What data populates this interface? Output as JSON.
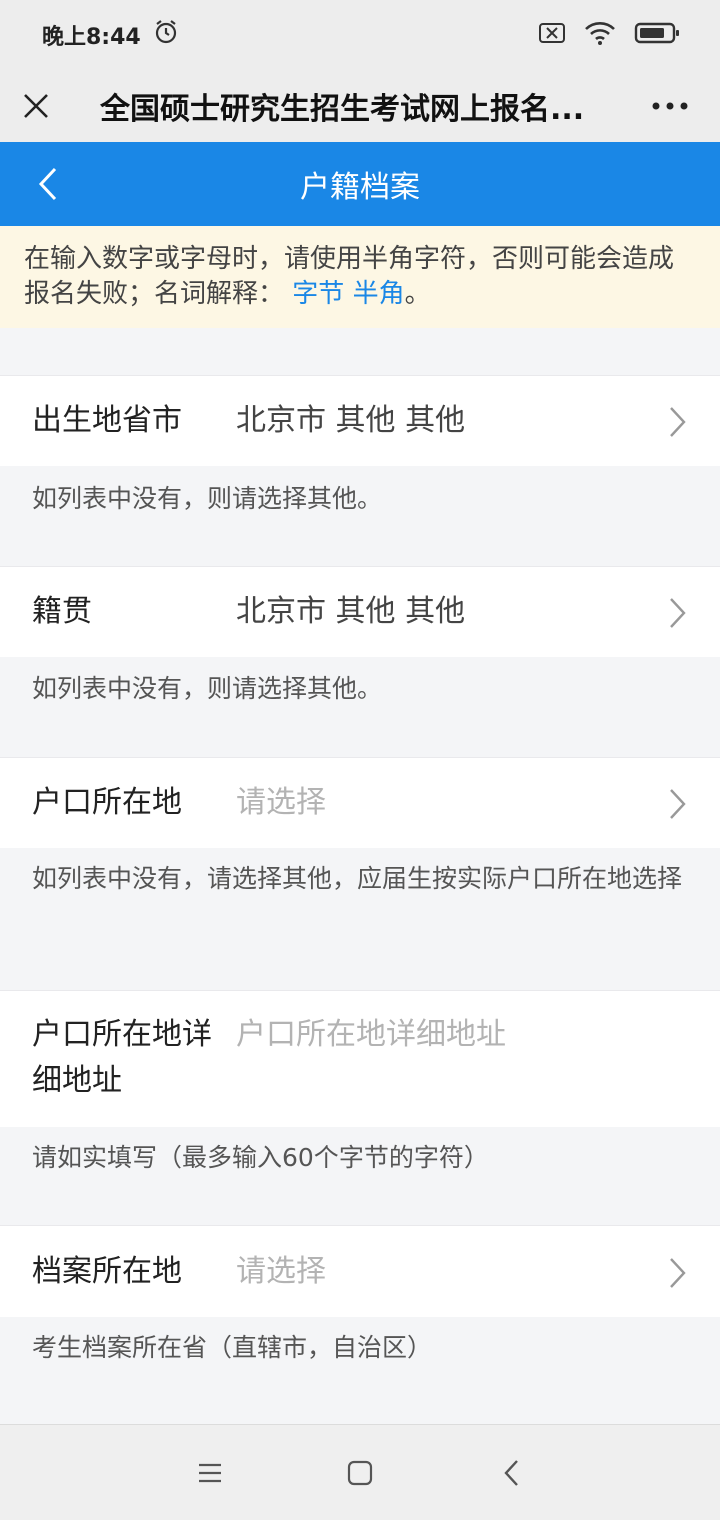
{
  "status_bar": {
    "time": "晚上8:44"
  },
  "wechat_bar": {
    "title": "全国硕士研究生招生考试网上报名..."
  },
  "header": {
    "title": "户籍档案"
  },
  "notice": {
    "text": "在输入数字或字母时，请使用半角字符，否则可能会造成报名失败；名词解释：",
    "links": [
      "字节",
      "半角"
    ],
    "suffix": "。"
  },
  "fields": [
    {
      "label": "出生地省市",
      "value": "北京市 其他 其他",
      "hint": "如列表中没有，则请选择其他。"
    },
    {
      "label": "籍贯",
      "value": "北京市 其他 其他",
      "hint": "如列表中没有，则请选择其他。"
    },
    {
      "label": "户口所在地",
      "placeholder": "请选择",
      "hint": "如列表中没有，请选择其他，应届生按实际户口所在地选择"
    },
    {
      "label_line1": "户口所在地详",
      "label_line2": "细地址",
      "placeholder": "户口所在地详细地址",
      "hint": "请如实填写（最多输入60个字节的字符）"
    },
    {
      "label": "档案所在地",
      "placeholder": "请选择",
      "hint": "考生档案所在省（直辖市，自治区）"
    }
  ],
  "colors": {
    "header": "#1a87e6",
    "link": "#1a87e6",
    "notice_bg": "#fdf7e4"
  }
}
